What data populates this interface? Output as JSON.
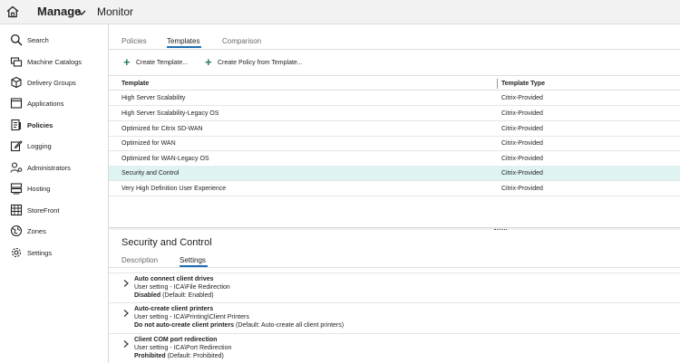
{
  "topbar": {
    "manage_label": "Manage",
    "monitor_label": "Monitor"
  },
  "sidebar": {
    "items": [
      {
        "label": "Search",
        "icon": "search-icon"
      },
      {
        "label": "Machine Catalogs",
        "icon": "machine-catalogs-icon"
      },
      {
        "label": "Delivery Groups",
        "icon": "delivery-groups-icon"
      },
      {
        "label": "Applications",
        "icon": "applications-icon"
      },
      {
        "label": "Policies",
        "icon": "policies-icon"
      },
      {
        "label": "Logging",
        "icon": "logging-icon"
      },
      {
        "label": "Administrators",
        "icon": "administrators-icon"
      },
      {
        "label": "Hosting",
        "icon": "hosting-icon"
      },
      {
        "label": "StoreFront",
        "icon": "storefront-icon"
      },
      {
        "label": "Zones",
        "icon": "zones-icon"
      },
      {
        "label": "Settings",
        "icon": "settings-icon"
      }
    ],
    "active": "Policies"
  },
  "tabs": [
    {
      "label": "Policies"
    },
    {
      "label": "Templates"
    },
    {
      "label": "Comparison"
    }
  ],
  "active_tab": "Templates",
  "toolbar": {
    "create_template": "Create Template...",
    "create_policy_from_template": "Create Policy from Template..."
  },
  "table": {
    "columns": [
      "Template",
      "Template Type"
    ],
    "rows": [
      {
        "template": "High Server Scalability",
        "type": "Citrix-Provided"
      },
      {
        "template": "High Server Scalability-Legacy OS",
        "type": "Citrix-Provided"
      },
      {
        "template": "Optimized for Citrix SD-WAN",
        "type": "Citrix-Provided"
      },
      {
        "template": "Optimized for WAN",
        "type": "Citrix-Provided"
      },
      {
        "template": "Optimized for WAN-Legacy OS",
        "type": "Citrix-Provided"
      },
      {
        "template": "Security and Control",
        "type": "Citrix-Provided"
      },
      {
        "template": "Very High Definition User Experience",
        "type": "Citrix-Provided"
      }
    ],
    "selected_row": "Security and Control"
  },
  "details": {
    "title": "Security and Control",
    "tabs": [
      {
        "label": "Description"
      },
      {
        "label": "Settings"
      }
    ],
    "active_tab": "Settings",
    "settings": [
      {
        "name": "Auto connect client drives",
        "path": "User setting - ICA\\File Redirection",
        "value": "Disabled",
        "default": "(Default: Enabled)"
      },
      {
        "name": "Auto-create client printers",
        "path": "User setting - ICA\\Printing\\Client Printers",
        "value": "Do not auto-create client printers",
        "default": "(Default: Auto-create all client printers)"
      },
      {
        "name": "Client COM port redirection",
        "path": "User setting - ICA\\Port Redirection",
        "value": "Prohibited",
        "default": "(Default: Prohibited)"
      }
    ]
  },
  "colors": {
    "accent": "#1f6fb5",
    "selected_row_bg": "#dff3f3",
    "plus_icon": "#2a7a5a"
  }
}
